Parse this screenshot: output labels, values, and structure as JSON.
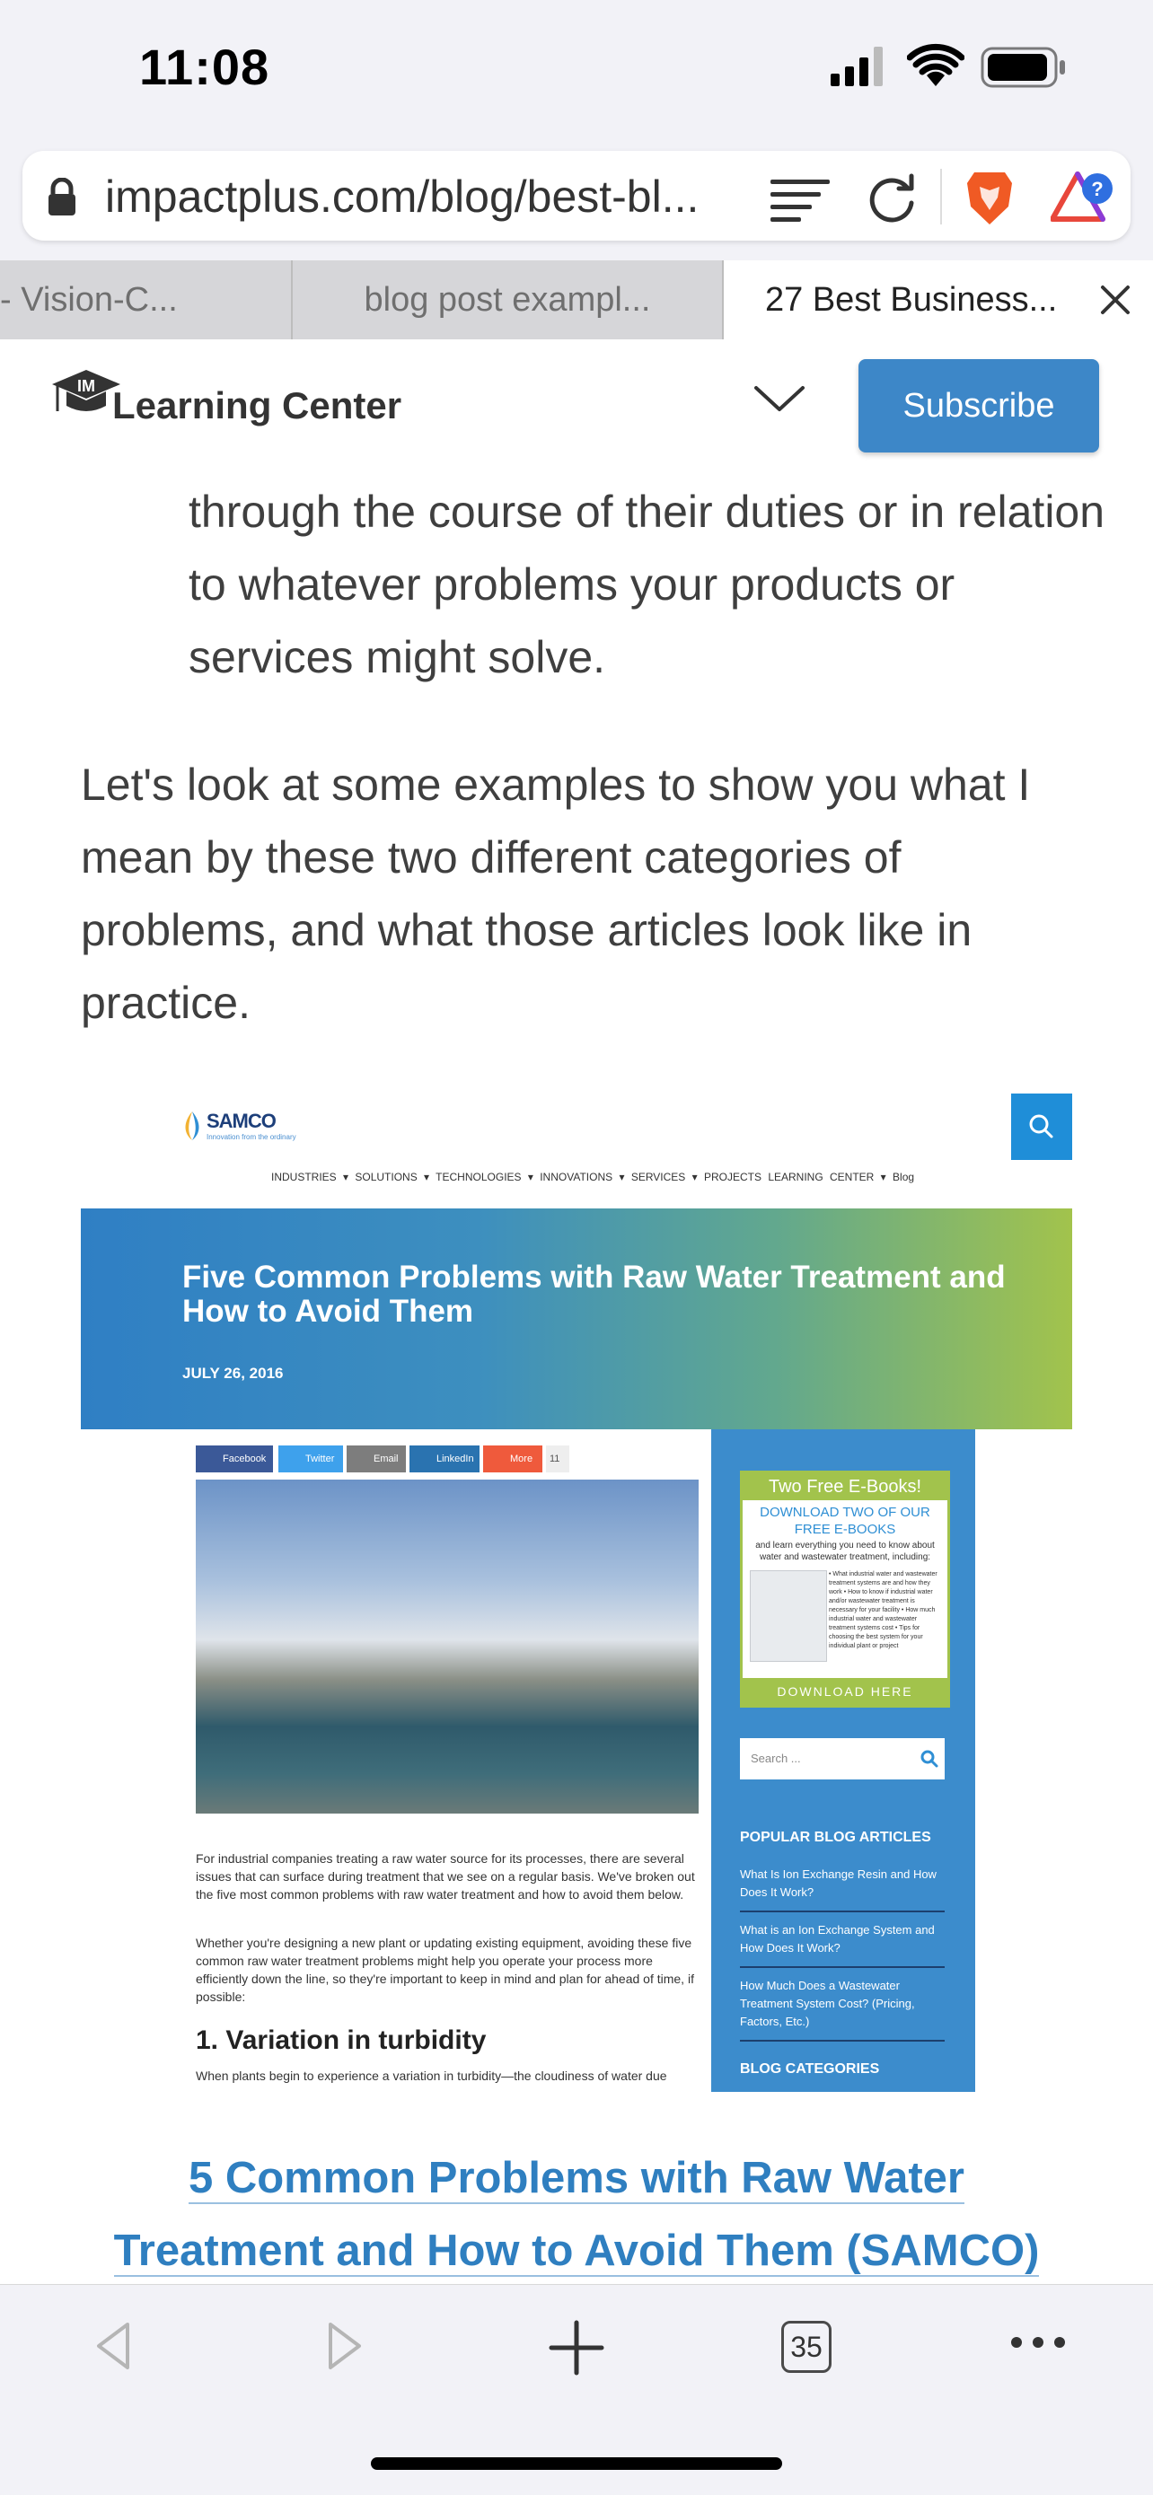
{
  "status_bar": {
    "time": "11:08"
  },
  "address_bar": {
    "url": "impactplus.com/blog/best-bl..."
  },
  "tabs": [
    {
      "label": "- Vision-C..."
    },
    {
      "label": "blog post exampl..."
    },
    {
      "label": "27 Best Business..."
    }
  ],
  "site_header": {
    "brand": "Learning Center",
    "subscribe_label": "Subscribe"
  },
  "article": {
    "paragraph_1": "through the course of their duties or in relation to whatever problems your products or services might solve.",
    "paragraph_2": "Let's look at some examples to show you what I mean by these two different categories of problems, and what those articles look like in practice."
  },
  "embedded_screenshot": {
    "logo_text": "SAMCO",
    "logo_tagline": "Innovation from the ordinary",
    "nav": "INDUSTRIES ▾   SOLUTIONS ▾   TECHNOLOGIES ▾   INNOVATIONS ▾   SERVICES ▾   PROJECTS   LEARNING CENTER ▾   Blog",
    "hero_title": "Five Common Problems with Raw Water Treatment and How to Avoid Them",
    "hero_date": "JULY 26, 2016",
    "share": {
      "facebook": "Facebook",
      "twitter": "Twitter",
      "email": "Email",
      "linkedin": "LinkedIn",
      "more": "More",
      "count": "11"
    },
    "body_1": "For industrial companies treating a raw water source for its processes, there are several issues that can surface during treatment that we see on a regular basis. We've broken out the five most common problems with raw water treatment and how to avoid them below.",
    "body_2": "Whether you're designing a new plant or updating existing equipment, avoiding these five common raw water treatment problems might help you operate your process more efficiently down the line, so they're important to keep in mind and plan for ahead of time, if possible:",
    "heading_1": "1. Variation in turbidity",
    "body_3": "When plants begin to experience a variation in turbidity—the cloudiness of water due",
    "sidebar": {
      "ebook_head": "Two Free E-Books!",
      "ebook_download": "DOWNLOAD TWO OF OUR FREE E-BOOKS",
      "ebook_sub": "and learn everything you need to know about water and wastewater treatment, including:",
      "ebook_list": "• What industrial water and wastewater treatment systems are and how they work • How to know if industrial water and/or wastewater treatment is necessary for your facility • How much industrial water and wastewater treatment systems cost • Tips for choosing the best system for your individual plant or project",
      "ebook_button": "DOWNLOAD HERE",
      "search_placeholder": "Search ...",
      "popular_heading": "POPULAR BLOG ARTICLES",
      "links": [
        "What Is Ion Exchange Resin and How Does It Work?",
        "What is an Ion Exchange System and How Does It Work?",
        "How Much Does a Wastewater Treatment System Cost? (Pricing, Factors, Etc.)"
      ],
      "categories_heading": "BLOG CATEGORIES"
    }
  },
  "caption": {
    "line_1": "5 Common Problems with Raw Water",
    "line_2": "Treatment and How to Avoid Them (SAMCO)"
  },
  "toolbar": {
    "tab_count": "35"
  },
  "colors": {
    "accent": "#3d87c8",
    "link": "#2f7fc0",
    "ui_bg": "#f2f2f7"
  }
}
